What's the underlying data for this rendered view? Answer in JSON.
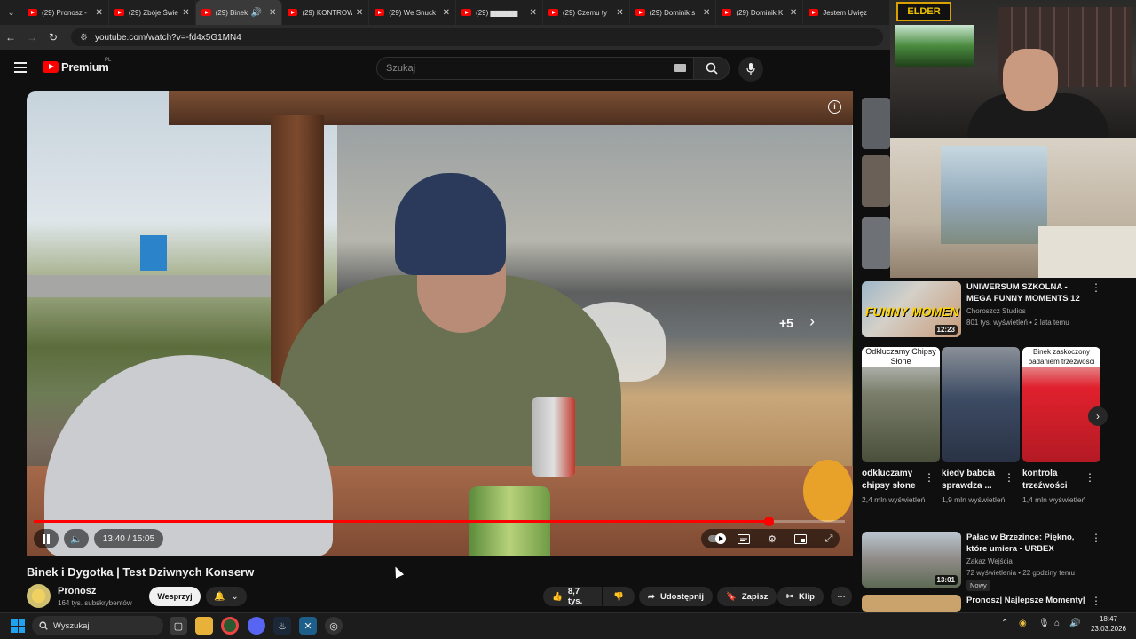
{
  "browser": {
    "tabs": [
      {
        "label": "(29) Pronosz -"
      },
      {
        "label": "(29) Zbóje Świe"
      },
      {
        "label": "(29) Binek",
        "active": true
      },
      {
        "label": "(29) KONTROW"
      },
      {
        "label": "(29) We Snuck"
      },
      {
        "label": "(29) ▆▆▆▆▆"
      },
      {
        "label": "(29) Czemu ty"
      },
      {
        "label": "(29) Dominik s"
      },
      {
        "label": "(29) Dominik K"
      },
      {
        "label": "Jestem Uwięz"
      }
    ],
    "url": "youtube.com/watch?v=-fd4x5G1MN4"
  },
  "youtube": {
    "logo_text": "Premium",
    "logo_region": "PL",
    "search_placeholder": "Szukaj"
  },
  "player": {
    "info_icon": "info-icon",
    "plus_label": "+5",
    "time": "13:40 / 15:05",
    "progress": 0.906
  },
  "video": {
    "title": "Binek i Dygotka | Test Dziwnych Konserw",
    "channel": "Pronosz",
    "subscribers": "164 tys. subskrybentów",
    "support_label": "Wesprzyj",
    "likes": "8,7 tys.",
    "share_label": "Udostępnij",
    "save_label": "Zapisz",
    "clip_label": "Klip"
  },
  "streamer": {
    "logo": "ELDER"
  },
  "recommendations": [
    {
      "title": "UNIWERSUM SZKOLNA - MEGA FUNNY MOMENTS 12",
      "channel": "Choroszcz Studios",
      "meta": "801 tys. wyświetleń • 2 lata temu",
      "duration": "12:23",
      "thumb_text": "FUNNY MOMEN"
    },
    {
      "title": "Pałac w Brzezince: Piękno, które umiera - URBEX",
      "channel": "Zakaz Wejścia",
      "meta": "72 wyświetlenia • 22 godziny temu",
      "duration": "13:01",
      "badge": "Nowy"
    },
    {
      "title": "Pronosz| Najlepsze Momenty|",
      "channel": "",
      "meta": "",
      "duration": ""
    }
  ],
  "shorts": [
    {
      "caption": "Odkluczamy Chipsy Słone",
      "title": "odkluczamy chipsy słone",
      "views": "2,4 mln wyświetleń"
    },
    {
      "caption": "",
      "title": "kiedy babcia sprawdza ...",
      "views": "1,9 mln wyświetleń"
    },
    {
      "caption": "Binek zaskoczony badaniem trzeźwości",
      "title": "kontrola trzeźwości",
      "views": "1,4 mln wyświetleń"
    }
  ],
  "taskbar": {
    "search_placeholder": "Wyszukaj",
    "time": "18:47",
    "date": "23.03.2026"
  }
}
